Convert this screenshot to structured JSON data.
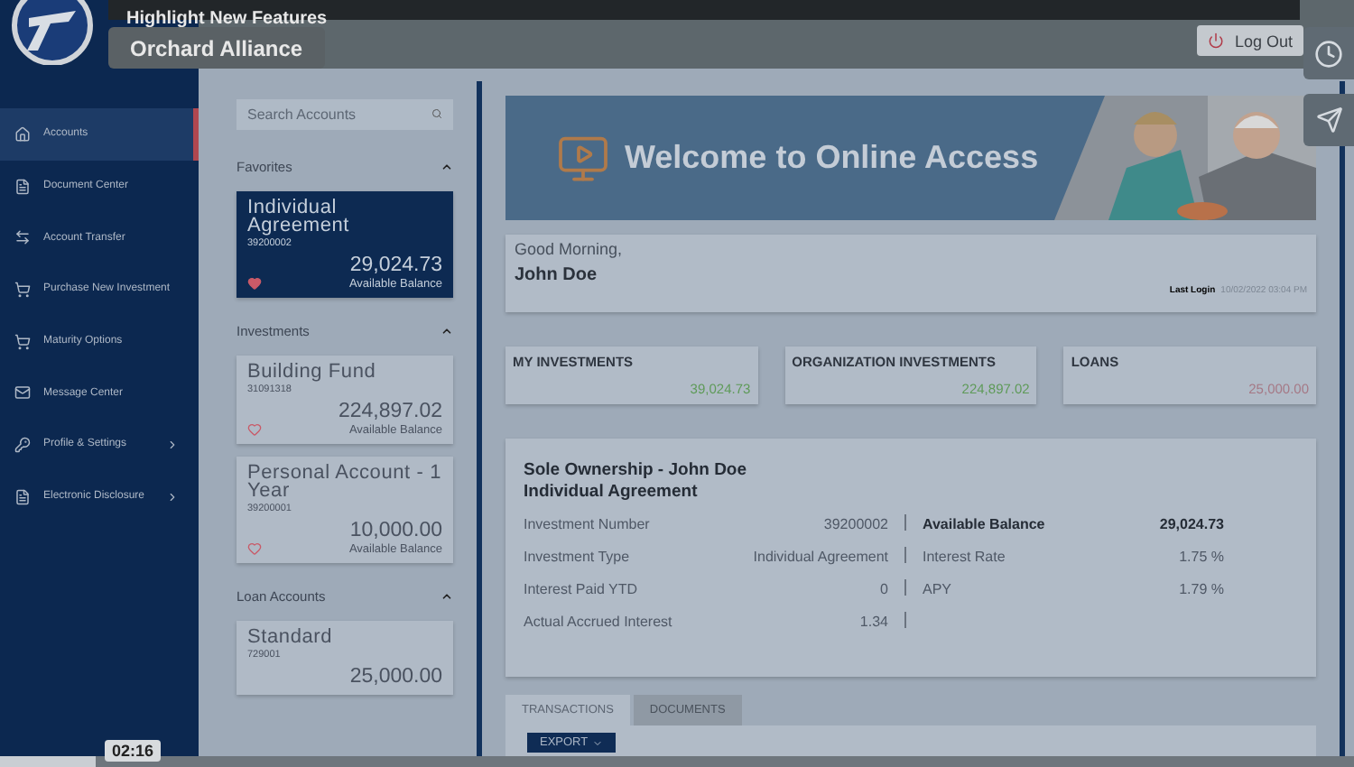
{
  "video": {
    "title": "Highlight New Features",
    "channel": "Orchard Alliance",
    "time": "02:16",
    "level": 0.07
  },
  "header": {
    "logout": "Log Out"
  },
  "sidebar": {
    "items": [
      {
        "label": "Accounts",
        "kind": "home",
        "selected": true,
        "submenu": false
      },
      {
        "label": "Document Center",
        "kind": "document",
        "selected": false,
        "submenu": false
      },
      {
        "label": "Account Transfer",
        "kind": "transfer",
        "selected": false,
        "submenu": false
      },
      {
        "label": "Purchase New Investment",
        "kind": "cart",
        "selected": false,
        "submenu": false
      },
      {
        "label": "Maturity Options",
        "kind": "cart",
        "selected": false,
        "submenu": false
      },
      {
        "label": "Message Center",
        "kind": "mail",
        "selected": false,
        "submenu": false
      },
      {
        "label": "Profile & Settings",
        "kind": "key",
        "selected": false,
        "submenu": true
      },
      {
        "label": "Electronic Disclosure",
        "kind": "document",
        "selected": false,
        "submenu": true
      }
    ]
  },
  "accounts": {
    "search": {
      "placeholder": "Search Accounts"
    },
    "sections": [
      {
        "title": "Favorites",
        "expanded": true,
        "items": [
          {
            "name": "Individual Agreement",
            "number": "39200002",
            "balance": "29,024.73",
            "balance_label": "Available Balance",
            "favorite": true,
            "selected": true
          }
        ]
      },
      {
        "title": "Investments",
        "expanded": true,
        "items": [
          {
            "name": "Building Fund",
            "number": "31091318",
            "balance": "224,897.02",
            "balance_label": "Available Balance",
            "favorite": false,
            "selected": false
          },
          {
            "name": "Personal Account - 1 Year",
            "number": "39200001",
            "balance": "10,000.00",
            "balance_label": "Available Balance",
            "favorite": false,
            "selected": false
          }
        ]
      },
      {
        "title": "Loan Accounts",
        "expanded": true,
        "items": [
          {
            "name": "Standard",
            "number": "729001",
            "balance": "25,000.00",
            "selected": false
          }
        ]
      }
    ]
  },
  "banner": {
    "title": "Welcome to Online Access"
  },
  "greeting": {
    "salutation": "Good Morning,",
    "name": "John Doe",
    "last_login_label": "Last Login",
    "last_login": "10/02/2022 03:04 PM"
  },
  "summary": [
    {
      "label": "MY INVESTMENTS",
      "value": "39,024.73",
      "color": "#5e9a58"
    },
    {
      "label": "ORGANIZATION INVESTMENTS",
      "value": "224,897.02",
      "color": "#5e9a58"
    },
    {
      "label": "LOANS",
      "value": "25,000.00",
      "color": "#a57885"
    }
  ],
  "details": {
    "title": "Sole Ownership - John Doe",
    "subtitle": "Individual Agreement",
    "rows": [
      {
        "label": "Investment Number",
        "value": "39200002",
        "label_2": "Available Balance",
        "value_2": "29,024.73",
        "bold_2": true
      },
      {
        "label": "Investment Type",
        "value": "Individual Agreement",
        "label_2": "Interest Rate",
        "value_2": "1.75 %",
        "bold_2": false
      },
      {
        "label": "Interest Paid YTD",
        "value": "0",
        "label_2": "APY",
        "value_2": "1.79 %",
        "bold_2": false
      },
      {
        "label": "Actual Accrued Interest",
        "value": "1.34"
      }
    ]
  },
  "tabs": [
    {
      "label": "TRANSACTIONS",
      "selected": true
    },
    {
      "label": "DOCUMENTS",
      "selected": false
    }
  ],
  "export": {
    "label": "EXPORT"
  }
}
